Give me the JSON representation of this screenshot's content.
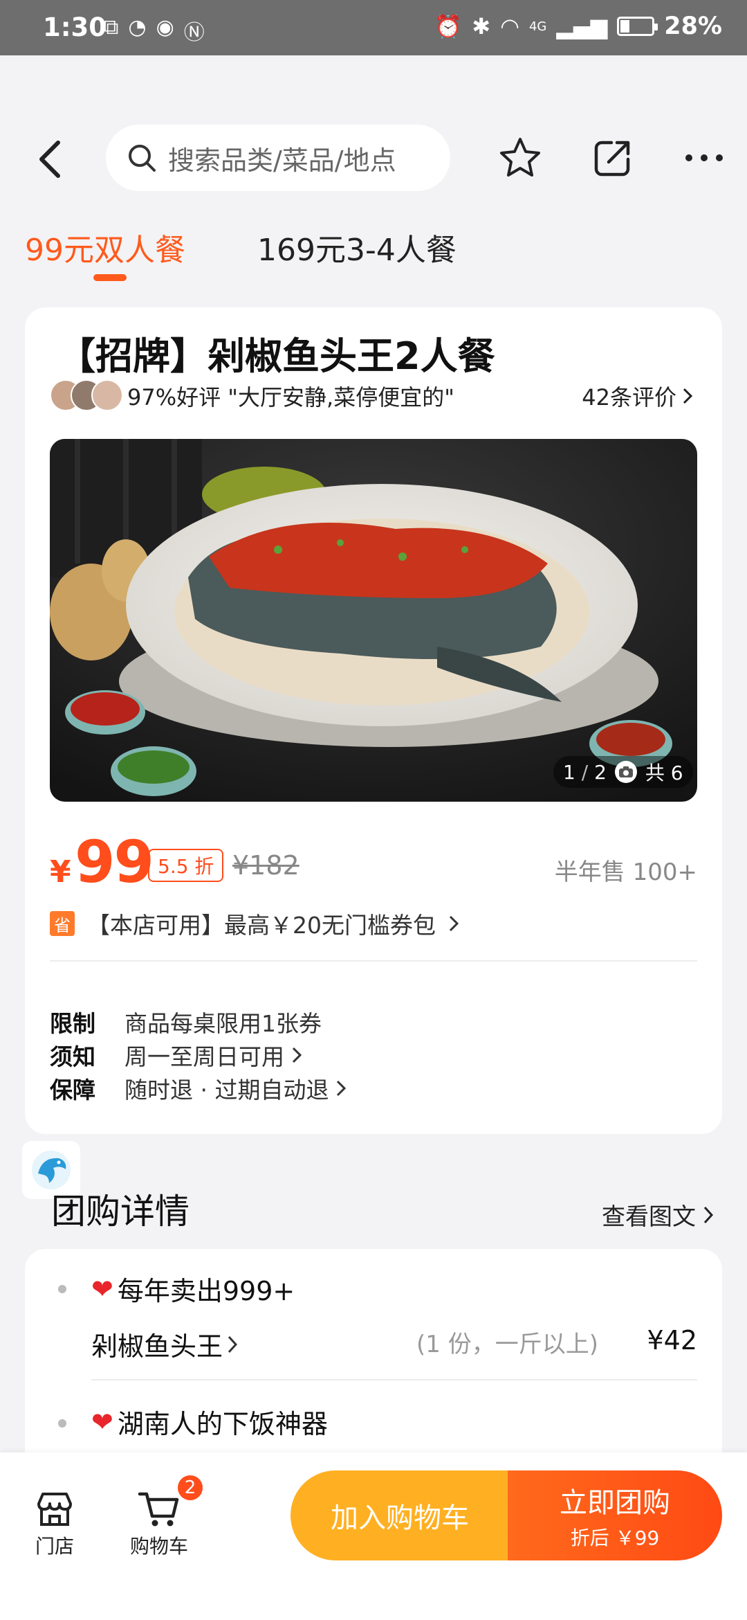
{
  "status_bar": {
    "time": "1:30",
    "network": "4G",
    "battery": "28%",
    "battery_level": 0.28
  },
  "header": {
    "search_placeholder": "搜索品类/菜品/地点",
    "icons": [
      "back-icon",
      "search-icon",
      "star-icon",
      "share-icon",
      "more-icon"
    ]
  },
  "tabs": [
    {
      "label": "99元双人餐",
      "active": true
    },
    {
      "label": "169元3-4人餐",
      "active": false
    }
  ],
  "product": {
    "title": "【招牌】剁椒鱼头王2人餐",
    "review_summary": "97%好评  \"大厅安静,菜停便宜的\"",
    "review_count": "42条评价",
    "photo_page": "1",
    "photo_total_pages": "2",
    "photo_count_label": "共 6",
    "price_symbol": "¥",
    "price": "99",
    "discount": "5.5 折",
    "original_price": "¥182",
    "sales": "半年售 100+",
    "coupon_badge": "省",
    "coupon_text": "【本店可用】最高￥20无门槛券包",
    "info": [
      {
        "key": "限制",
        "value": "商品每桌限用1张券"
      },
      {
        "key": "须知",
        "value": "周一至周日可用"
      },
      {
        "key": "保障",
        "value": "随时退 · 过期自动退"
      }
    ]
  },
  "details": {
    "title": "团购详情",
    "more": "查看图文",
    "items": [
      {
        "heading": "每年卖出999+",
        "dish": "剁椒鱼头王",
        "portion": "(1 份，一斤以上)",
        "price": "¥42"
      },
      {
        "heading": "湖南人的下饭神器"
      }
    ]
  },
  "bottom_bar": {
    "store_label": "门店",
    "cart_label": "购物车",
    "cart_count": "2",
    "add_to_cart": "加入购物车",
    "buy_now": "立即团购",
    "buy_sub": "折后 ￥99"
  },
  "colors": {
    "accent": "#ff5a1c",
    "cart_button": "#ffb022",
    "heart": "#e8262b"
  }
}
